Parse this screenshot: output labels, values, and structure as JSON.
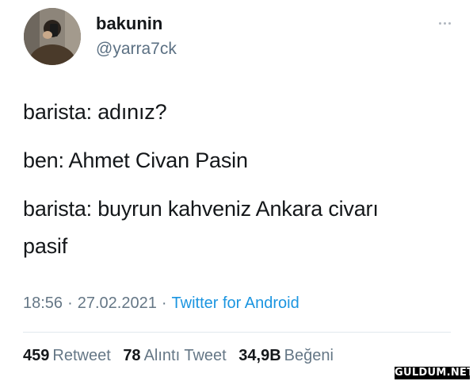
{
  "author": {
    "display_name": "bakunin",
    "handle": "@yarra7ck"
  },
  "more_icon": "more-horizontal-icon",
  "body_lines": [
    "barista: adınız?",
    "ben: Ahmet Civan Pasin",
    "barista: buyrun kahveniz Ankara civarı",
    "pasif"
  ],
  "meta": {
    "time": "18:56",
    "separator": "·",
    "date": "27.02.2021",
    "source": "Twitter for Android"
  },
  "stats": {
    "retweets": {
      "count": "459",
      "label": "Retweet"
    },
    "quotes": {
      "count": "78",
      "label": "Alıntı Tweet"
    },
    "likes": {
      "count": "34,9B",
      "label": "Beğeni"
    }
  },
  "watermark": "GULDUM.NET",
  "colors": {
    "text": "#14171a",
    "secondary": "#657786",
    "link": "#1b95e0",
    "divider": "#e1e8ed"
  }
}
